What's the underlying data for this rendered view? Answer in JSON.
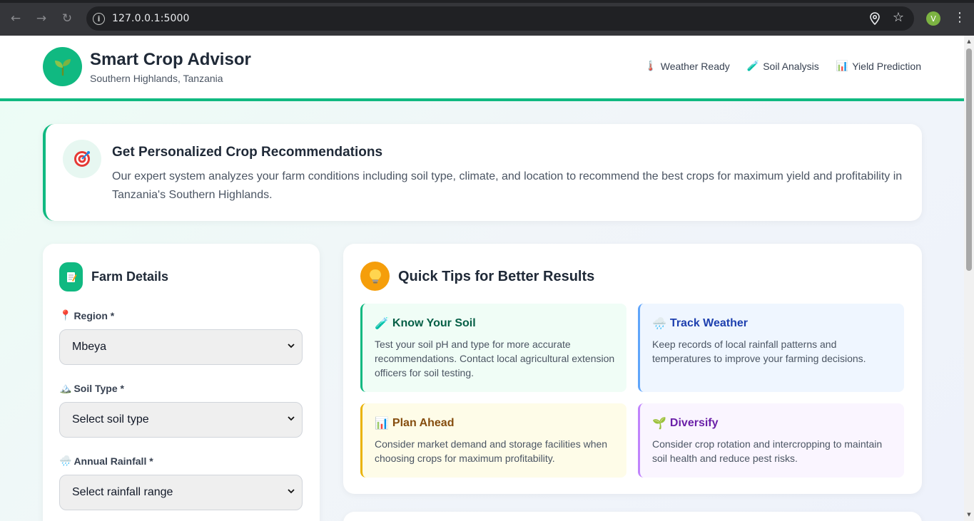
{
  "browser": {
    "url": "127.0.0.1:5000",
    "profile_initial": "V",
    "accent": "#7cb342"
  },
  "header": {
    "logo_icon": "🌱",
    "title": "Smart Crop Advisor",
    "subtitle": "Southern Highlands, Tanzania",
    "nav": [
      {
        "icon": "🌡️",
        "label": "Weather Ready"
      },
      {
        "icon": "🧪",
        "label": "Soil Analysis"
      },
      {
        "icon": "📊",
        "label": "Yield Prediction"
      }
    ]
  },
  "intro": {
    "icon": "🎯",
    "title": "Get Personalized Crop Recommendations",
    "text": "Our expert system analyzes your farm conditions including soil type, climate, and location to recommend the best crops for maximum yield and profitability in Tanzania's Southern Highlands."
  },
  "farm": {
    "icon": "📝",
    "title": "Farm Details",
    "fields": [
      {
        "icon": "📍",
        "label": "Region *",
        "value": "Mbeya"
      },
      {
        "icon": "🏔️",
        "label": "Soil Type *",
        "value": "Select soil type"
      },
      {
        "icon": "🌧️",
        "label": "Annual Rainfall *",
        "value": "Select rainfall range"
      }
    ]
  },
  "tips": {
    "icon": "💡",
    "title": "Quick Tips for Better Results",
    "items": [
      {
        "icon": "🧪",
        "title": "Know Your Soil",
        "text": "Test your soil pH and type for more accurate recommendations. Contact local agricultural extension officers for soil testing."
      },
      {
        "icon": "🌧️",
        "title": "Track Weather",
        "text": "Keep records of local rainfall patterns and temperatures to improve your farming decisions."
      },
      {
        "icon": "📊",
        "title": "Plan Ahead",
        "text": "Consider market demand and storage facilities when choosing crops for maximum profitability."
      },
      {
        "icon": "🌱",
        "title": "Diversify",
        "text": "Consider crop rotation and intercropping to maintain soil health and reduce pest risks."
      }
    ]
  },
  "colors": {
    "primary": "#10b981",
    "tips_accent": "#f59e0b"
  }
}
